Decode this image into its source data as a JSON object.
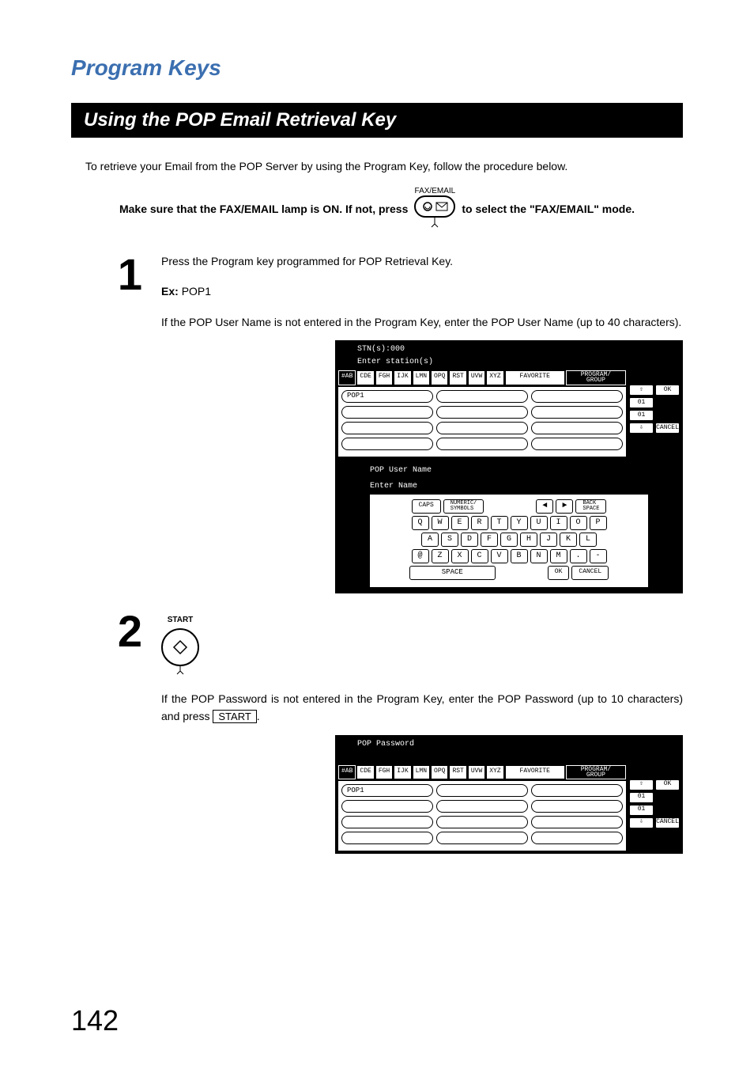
{
  "page": {
    "h1": "Program Keys",
    "banner": "Using the POP Email Retrieval Key",
    "intro": "To retrieve your Email from the POP Server by using the Program Key, follow the procedure below.",
    "mode_pre": "Make sure that the FAX/EMAIL lamp is ON.  If not, press",
    "mode_post": "to select the \"FAX/EMAIL\" mode.",
    "fax_label": "FAX/EMAIL",
    "page_number": "142"
  },
  "step1": {
    "num": "1",
    "line1": "Press the Program key programmed for POP Retrieval Key.",
    "ex_label": "Ex:",
    "ex_value": "POP1",
    "line2": "If the POP User Name is not entered in the Program Key, enter the POP User Name (up to 40 characters).",
    "screen": {
      "hdr1": "STN(s):000",
      "hdr2": "Enter station(s)",
      "tabs": [
        "#AB",
        "CDE",
        "FGH",
        "IJK",
        "LMN",
        "OPQ",
        "RST",
        "UVW",
        "XYZ",
        "FAVORITE",
        "PROGRAM/\nGROUP"
      ],
      "slot1": "POP1",
      "ok": "OK",
      "pg1": "01",
      "pg2": "01",
      "cancel": "CANCEL",
      "kbtitle1": "POP User Name",
      "kbtitle2": "Enter Name",
      "topkeys": [
        "CAPS",
        "NUMERIC/\nSYMBOLS"
      ],
      "navkeys": [
        "◄",
        "►",
        "BACK\nSPACE"
      ],
      "row1": [
        "Q",
        "W",
        "E",
        "R",
        "T",
        "Y",
        "U",
        "I",
        "O",
        "P"
      ],
      "row2": [
        "A",
        "S",
        "D",
        "F",
        "G",
        "H",
        "J",
        "K",
        "L"
      ],
      "row3": [
        "@",
        "Z",
        "X",
        "C",
        "V",
        "B",
        "N",
        "M",
        ".",
        "-"
      ],
      "bottom": [
        "SPACE",
        "OK",
        "CANCEL"
      ]
    }
  },
  "step2": {
    "num": "2",
    "start_label": "START",
    "line_pre": "If the POP Password is not entered in the Program Key, enter the POP Password (up to 10 characters) and press ",
    "start_box": "START",
    "line_post": ".",
    "screen": {
      "hdr1": "POP Password",
      "tabs": [
        "#AB",
        "CDE",
        "FGH",
        "IJK",
        "LMN",
        "OPQ",
        "RST",
        "UVW",
        "XYZ",
        "FAVORITE",
        "PROGRAM/\nGROUP"
      ],
      "slot1": "POP1",
      "ok": "OK",
      "pg1": "01",
      "pg2": "01",
      "cancel": "CANCEL"
    }
  }
}
